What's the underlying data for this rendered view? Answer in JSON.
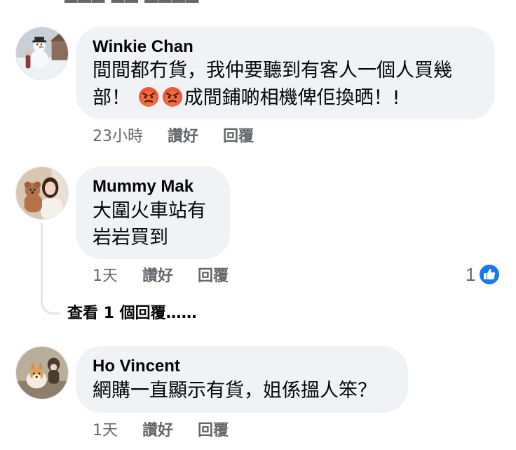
{
  "colors": {
    "bubble": "#f0f2f5",
    "meta_text": "#65676b",
    "like_blue": "#1877f2",
    "thread_line": "#e4e6eb"
  },
  "comments": [
    {
      "author": "Winkie Chan",
      "text_line1": "間間都冇貨，我仲要聽到有客人一個人買幾",
      "text_line2_prefix": "部！",
      "emojis": [
        "angry-face-icon",
        "angry-face-icon"
      ],
      "text_line2_suffix": "成間鋪啲相機俾佢換晒！!",
      "time": "23小時",
      "like_label": "讚好",
      "reply_label": "回覆"
    },
    {
      "author": "Mummy Mak",
      "text_line1": "大圍火車站有",
      "text_line2": "岩岩買到",
      "time": "1天",
      "like_label": "讚好",
      "reply_label": "回覆",
      "reaction_count": "1",
      "reaction_icon": "like-thumb-icon"
    },
    {
      "author": "Ho Vincent",
      "text_line1": "網購一直顯示有貨，姐係搵人笨？",
      "time": "1天",
      "like_label": "讚好",
      "reply_label": "回覆"
    }
  ],
  "view_replies": "查看 1 個回覆……"
}
